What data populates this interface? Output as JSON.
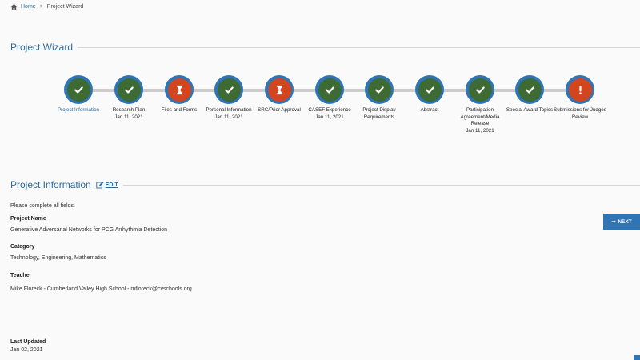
{
  "breadcrumb": {
    "home": "Home",
    "separator": ">",
    "current": "Project Wizard"
  },
  "wizard": {
    "title": "Project Wizard",
    "steps": [
      {
        "label": "Project Information",
        "date": "",
        "status": "complete",
        "active": true
      },
      {
        "label": "Research Plan",
        "date": "Jan 11, 2021",
        "status": "complete",
        "active": false
      },
      {
        "label": "Files and Forms",
        "date": "",
        "status": "pending",
        "active": false
      },
      {
        "label": "Personal Information",
        "date": "Jan 11, 2021",
        "status": "complete",
        "active": false
      },
      {
        "label": "SRC/Prior Approval",
        "date": "",
        "status": "pending",
        "active": false
      },
      {
        "label": "CASEF Experience",
        "date": "Jan 11, 2021",
        "status": "complete",
        "active": false
      },
      {
        "label": "Project Display Requirements",
        "date": "",
        "status": "complete",
        "active": false
      },
      {
        "label": "Abstract",
        "date": "",
        "status": "complete",
        "active": false
      },
      {
        "label": "Participation Agreement/Media Release",
        "date": "Jan 11, 2021",
        "status": "complete",
        "active": false
      },
      {
        "label": "Special Award Topics",
        "date": "",
        "status": "complete",
        "active": false
      },
      {
        "label": "Submissions for Judges Review",
        "date": "",
        "status": "alert",
        "active": false
      }
    ]
  },
  "project_info": {
    "title": "Project Information",
    "edit_label": "EDIT",
    "intro": "Please complete all fields.",
    "fields": [
      {
        "label": "Project Name",
        "value": "Generative Adversarial Networks for PCG Arrhythmia Detection"
      },
      {
        "label": "Category",
        "value": "Technology, Engineering, Mathematics"
      },
      {
        "label": "Teacher",
        "value": "Mike Floreck - Cumberland Valley High School - mfloreck@cvschools.org"
      },
      {
        "label": "Last Updated",
        "value": "Jan 02, 2021"
      }
    ],
    "next_label": "NEXT"
  },
  "colors": {
    "accent": "#2f74b5",
    "complete": "#3e6a33",
    "pending": "#d3451f",
    "track": "#cdcdcd"
  },
  "icons": {
    "home": "home-icon",
    "complete": "check-icon",
    "pending": "hourglass-icon",
    "alert": "exclamation-icon",
    "edit": "edit-icon",
    "next": "arrow-right-icon"
  }
}
